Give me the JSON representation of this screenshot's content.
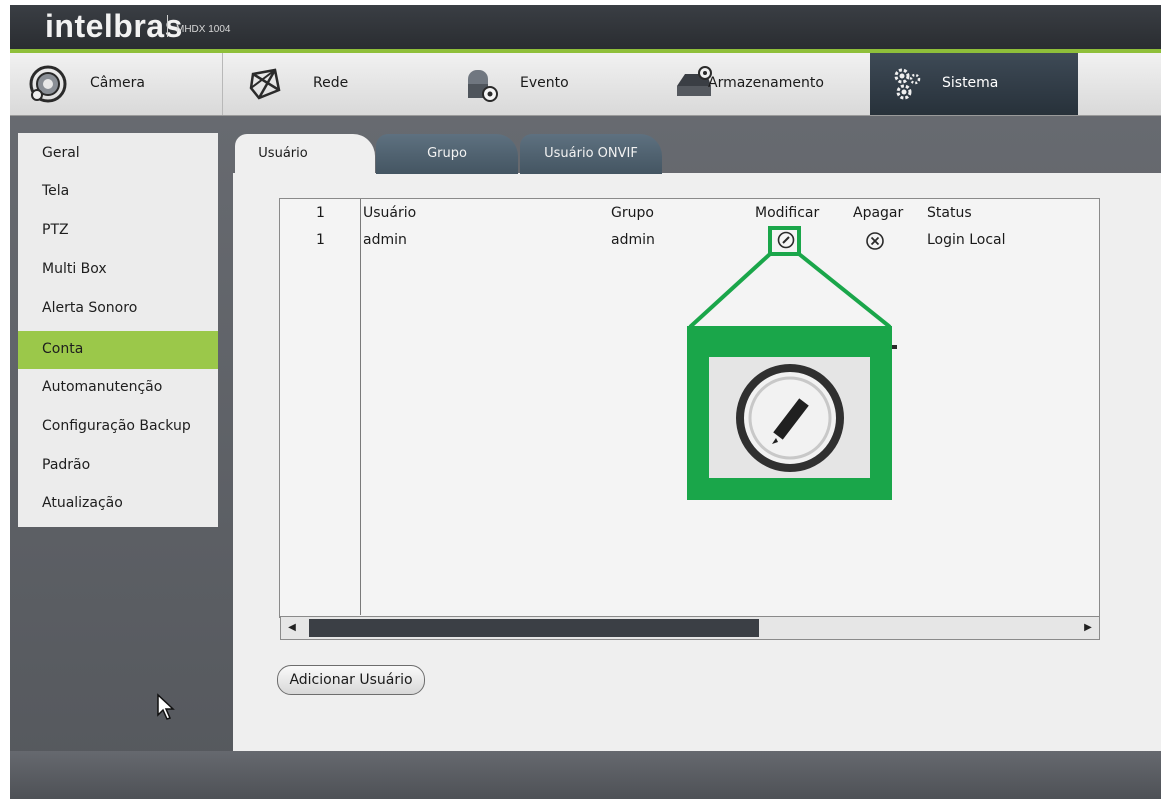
{
  "header": {
    "brand": "intelbras",
    "model": "MHDX 1004"
  },
  "main_menu": [
    {
      "label": "Câmera",
      "icon": "camera-lens-icon"
    },
    {
      "label": "Rede",
      "icon": "network-icon"
    },
    {
      "label": "Evento",
      "icon": "event-alarm-icon"
    },
    {
      "label": "Armazenamento",
      "icon": "storage-hdd-icon"
    },
    {
      "label": "Sistema",
      "icon": "gears-icon"
    }
  ],
  "active_menu": "Sistema",
  "sidebar": {
    "items": [
      {
        "label": "Geral"
      },
      {
        "label": "Tela"
      },
      {
        "label": "PTZ"
      },
      {
        "label": "Multi Box"
      },
      {
        "label": "Alerta Sonoro"
      },
      {
        "label": "Conta"
      },
      {
        "label": "Automanutenção"
      },
      {
        "label": "Configuração Backup"
      },
      {
        "label": "Padrão"
      },
      {
        "label": "Atualização"
      }
    ],
    "active": "Conta"
  },
  "tabs": [
    {
      "label": "Usuário"
    },
    {
      "label": "Grupo"
    },
    {
      "label": "Usuário ONVIF"
    }
  ],
  "active_tab": "Usuário",
  "table": {
    "headers": {
      "index": "1",
      "user": "Usuário",
      "group": "Grupo",
      "modify": "Modificar",
      "delete": "Apagar",
      "status": "Status"
    },
    "rows": [
      {
        "index": "1",
        "user": "admin",
        "group": "admin",
        "status": "Login Local"
      }
    ]
  },
  "add_user_button": "Adicionar Usuário",
  "colors": {
    "accent_green": "#9bc84a",
    "highlight_green": "#1aa64a",
    "active_menu_bg": "#2f3a44"
  }
}
